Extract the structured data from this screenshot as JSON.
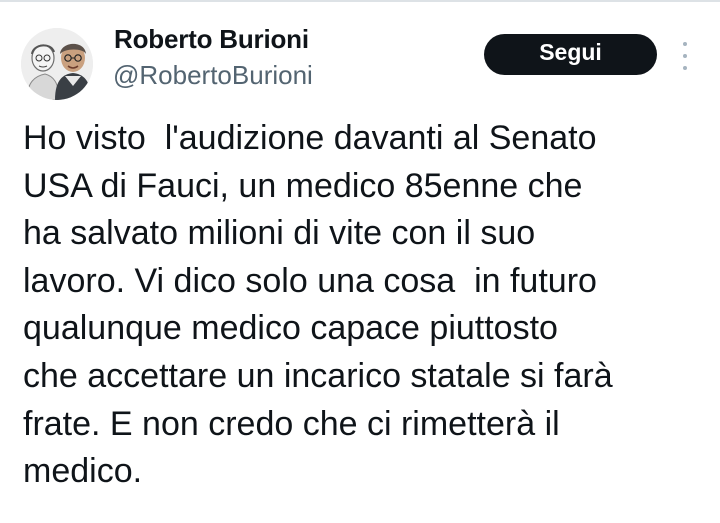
{
  "tweet": {
    "author": {
      "display_name": "Roberto Burioni",
      "handle": "@RobertoBurioni",
      "avatar_icon": "profile-photo-avatar"
    },
    "follow_button_label": "Segui",
    "more_icon": "vertical-ellipsis-icon",
    "text_lines": [
      "Ho visto  l'audizione davanti al Senato",
      "USA di Fauci, un medico 85enne che",
      "ha salvato milioni di vite con il suo",
      "lavoro. Vi dico solo una cosa  in futuro",
      "qualunque medico capace piuttosto",
      "che accettare un incarico statale si farà",
      "frate. E non credo che ci rimetterà il",
      "medico."
    ]
  },
  "colors": {
    "text_primary": "#0f1419",
    "text_secondary": "#536471",
    "button_bg": "#0f1419",
    "button_text": "#ffffff",
    "divider": "#dde2e6"
  }
}
